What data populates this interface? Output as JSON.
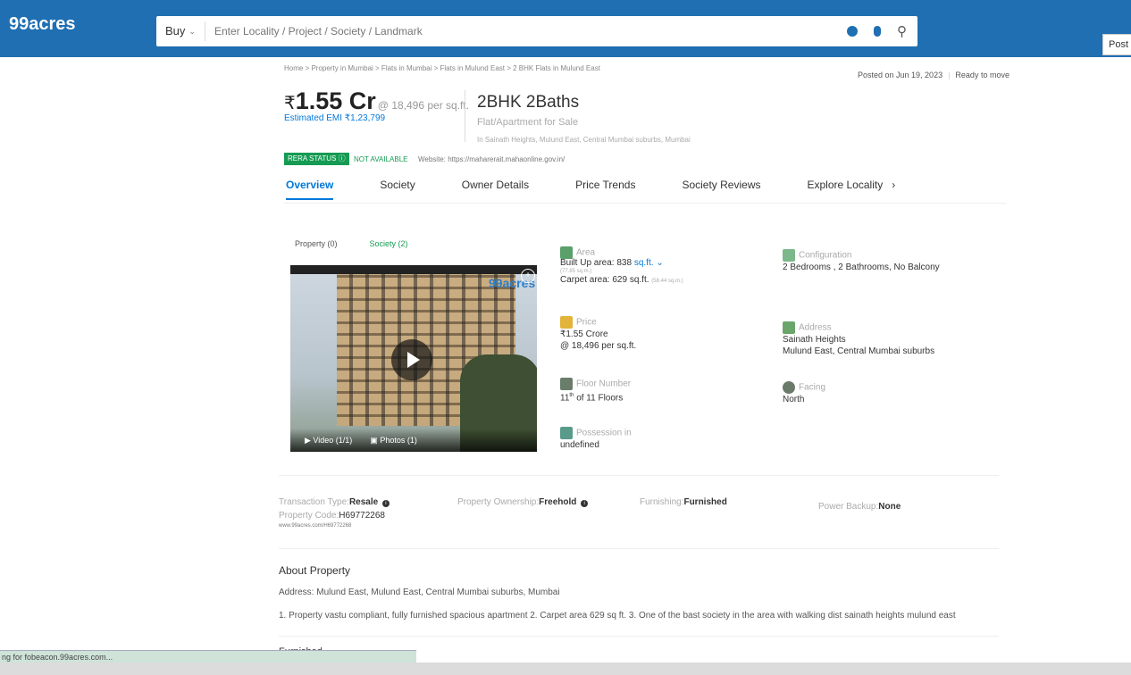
{
  "header": {
    "logo": "99acres",
    "buy_label": "Buy",
    "search_placeholder": "Enter Locality / Project / Society / Landmark",
    "post_label": "Post"
  },
  "breadcrumb": "Home > Property in Mumbai > Flats in Mumbai > Flats in Mulund East > 2 BHK Flats in Mulund East",
  "posted": {
    "date": "Posted on Jun 19, 2023",
    "status": "Ready to move"
  },
  "listing": {
    "currency": "₹",
    "price": "1.55 Cr",
    "price_per_sqft": "@ 18,496 per sq.ft.",
    "emi": "Estimated EMI ₹1,23,799",
    "title": "2BHK 2Baths",
    "subtype": "Flat/Apartment for Sale",
    "location": "In Sainath Heights, Mulund East, Central Mumbai suburbs, Mumbai"
  },
  "rera": {
    "badge": "RERA STATUS",
    "status": "NOT AVAILABLE",
    "website": "Website: https://maharerait.mahaonline.gov.in/"
  },
  "tabs": [
    "Overview",
    "Society",
    "Owner Details",
    "Price Trends",
    "Society Reviews",
    "Explore Locality"
  ],
  "media": {
    "tab_property": "Property (0)",
    "tab_society": "Society (2)",
    "watermark": "99acres",
    "video_label": "Video (1/1)",
    "photos_label": "Photos (1)"
  },
  "features": {
    "area": {
      "label": "Area",
      "builtup": "Built Up area: 838",
      "unit": "sq.ft.",
      "builtup_sqm": "(77.85 sq.m.)",
      "carpet": "Carpet area: 629 sq.ft.",
      "carpet_sqm": "(58.44 sq.m.)"
    },
    "configuration": {
      "label": "Configuration",
      "value": "2 Bedrooms , 2 Bathrooms, No Balcony"
    },
    "price": {
      "label": "Price",
      "value": "₹1.55 Crore",
      "per_sqft": "@ 18,496 per sq.ft."
    },
    "address": {
      "label": "Address",
      "line1": "Sainath Heights",
      "line2": "Mulund East, Central Mumbai suburbs"
    },
    "floor": {
      "label": "Floor Number",
      "value": "11",
      "suffix": "th",
      "of": "of 11 Floors"
    },
    "facing": {
      "label": "Facing",
      "value": "North"
    },
    "possession": {
      "label": "Possession in",
      "value": "undefined"
    }
  },
  "details": {
    "transaction_label": "Transaction Type:",
    "transaction_value": "Resale",
    "ownership_label": "Property Ownership:",
    "ownership_value": "Freehold",
    "furnishing_label": "Furnishing:",
    "furnishing_value": "Furnished",
    "backup_label": "Power Backup:",
    "backup_value": "None",
    "code_label": "Property Code:",
    "code_value": "H69772268",
    "code_url": "www.99acres.com/H69772268"
  },
  "about": {
    "title": "About Property",
    "address": "Address: Mulund East, Mulund East, Central Mumbai suburbs, Mumbai",
    "description": "1. Property vastu compliant, fully furnished spacious apartment 2. Carpet area 629 sq ft. 3. One of the bast society in the area with walking dist sainath heights mulund east"
  },
  "furnished_heading": "Furnished",
  "status_bar": "ng for fobeacon.99acres.com..."
}
